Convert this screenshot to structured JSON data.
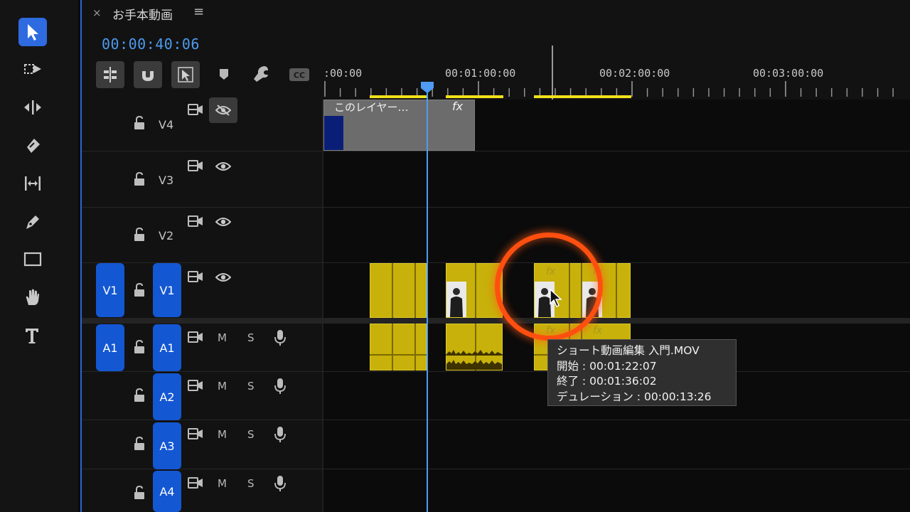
{
  "sequence": {
    "tab_close": "×",
    "tab_title": "お手本動画",
    "tab_menu": "≡",
    "timecode": "00:00:40:06"
  },
  "ruler": {
    "labels": [
      ":00:00",
      "00:01:00:00",
      "00:02:00:00",
      "00:03:00:00"
    ],
    "playhead_timecode": "00:00:40:06"
  },
  "tools": [
    {
      "name": "selection-tool",
      "active": true
    },
    {
      "name": "track-select-tool"
    },
    {
      "name": "ripple-edit-tool"
    },
    {
      "name": "razor-tool"
    },
    {
      "name": "slip-tool"
    },
    {
      "name": "pen-tool"
    },
    {
      "name": "rectangle-tool"
    },
    {
      "name": "hand-tool"
    },
    {
      "name": "type-tool"
    }
  ],
  "tracks": {
    "video": [
      {
        "label": "V4"
      },
      {
        "label": "V3"
      },
      {
        "label": "V2"
      },
      {
        "label": "V1",
        "source_patch": "V1"
      }
    ],
    "audio": [
      {
        "label": "A1",
        "source_patch": "A1",
        "mute": "M",
        "solo": "S"
      },
      {
        "label": "A2",
        "mute": "M",
        "solo": "S"
      },
      {
        "label": "A3",
        "mute": "M",
        "solo": "S"
      },
      {
        "label": "A4",
        "mute": "M",
        "solo": "S"
      }
    ]
  },
  "clips": {
    "graphic_label": "このレイヤー…",
    "fx_label": "fx"
  },
  "tooltip": {
    "name": "ショート動画編集 入門.MOV",
    "start": "開始 : 00:01:22:07",
    "end": "終了 : 00:01:36:02",
    "duration": "デュレーション : 00:00:13:26"
  },
  "colors": {
    "accent_blue": "#2f6be0",
    "track_badge_blue": "#1457d2",
    "timecode_blue": "#4d9bf0",
    "clip_yellow": "#c8b10a",
    "work_area_yellow": "#f1e11b",
    "highlight_orange": "#ff4f10"
  }
}
